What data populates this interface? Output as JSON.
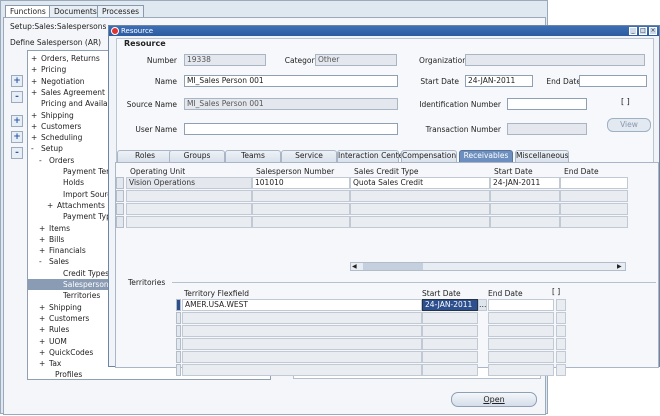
{
  "navigator": {
    "tabs": [
      "Functions",
      "Documents",
      "Processes"
    ],
    "setup_path": "Setup:Sales:Salespersons",
    "define_label": "Define Salesperson (AR)",
    "open_label": "Open",
    "tree": [
      {
        "prefix": "+",
        "label": "Orders, Returns",
        "indent": 0
      },
      {
        "prefix": "+",
        "label": "Pricing",
        "indent": 0
      },
      {
        "prefix": "+",
        "label": "Negotiation",
        "indent": 0
      },
      {
        "prefix": "+",
        "label": "Sales Agreement",
        "indent": 0
      },
      {
        "prefix": "",
        "label": "Pricing and Availability",
        "indent": 0
      },
      {
        "prefix": "+",
        "label": "Shipping",
        "indent": 0
      },
      {
        "prefix": "+",
        "label": "Customers",
        "indent": 0
      },
      {
        "prefix": "+",
        "label": "Scheduling",
        "indent": 0
      },
      {
        "prefix": "-",
        "label": "Setup",
        "indent": 0
      },
      {
        "prefix": "-",
        "label": "Orders",
        "indent": 1
      },
      {
        "prefix": "",
        "label": "Payment Terms",
        "indent": 2
      },
      {
        "prefix": "",
        "label": "Holds",
        "indent": 2
      },
      {
        "prefix": "",
        "label": "Import Sources",
        "indent": 2
      },
      {
        "prefix": "+",
        "label": "Attachments",
        "indent": 2
      },
      {
        "prefix": "",
        "label": "Payment Types",
        "indent": 2
      },
      {
        "prefix": "+",
        "label": "Items",
        "indent": 1
      },
      {
        "prefix": "+",
        "label": "Bills",
        "indent": 1
      },
      {
        "prefix": "+",
        "label": "Financials",
        "indent": 1
      },
      {
        "prefix": "-",
        "label": "Sales",
        "indent": 1
      },
      {
        "prefix": "",
        "label": "Credit Types",
        "indent": 2
      },
      {
        "prefix": "",
        "label": "Salespersons",
        "indent": 2,
        "selected": true
      },
      {
        "prefix": "",
        "label": "Territories",
        "indent": 2
      },
      {
        "prefix": "+",
        "label": "Shipping",
        "indent": 1
      },
      {
        "prefix": "+",
        "label": "Customers",
        "indent": 1
      },
      {
        "prefix": "+",
        "label": "Rules",
        "indent": 1
      },
      {
        "prefix": "+",
        "label": "UOM",
        "indent": 1
      },
      {
        "prefix": "+",
        "label": "QuickCodes",
        "indent": 1
      },
      {
        "prefix": "+",
        "label": "Tax",
        "indent": 1
      },
      {
        "prefix": "",
        "label": "Profiles",
        "indent": 1
      }
    ],
    "side_buttons": [
      "+",
      "-",
      "+",
      "+",
      "-"
    ]
  },
  "resource": {
    "title": "Resource",
    "section_title": "Resource",
    "labels": {
      "number": "Number",
      "category": "Category",
      "organization": "Organization",
      "name": "Name",
      "start_date": "Start Date",
      "end_date": "End Date",
      "source_name": "Source Name",
      "identification_number": "Identification Number",
      "user_name": "User Name",
      "transaction_number": "Transaction Number"
    },
    "values": {
      "number": "19338",
      "category": "Other",
      "organization": "",
      "name": "MI_Sales Person 001",
      "start_date": "24-JAN-2011",
      "end_date": "",
      "source_name": "MI_Sales Person 001",
      "identification_number": "",
      "user_name": "",
      "transaction_number": ""
    },
    "bracket_label": "[ ]",
    "view_label": "View",
    "tabs": [
      "Roles",
      "Groups",
      "Teams",
      "Service",
      "Interaction Center",
      "Compensation",
      "Receivables",
      "Miscellaneous"
    ],
    "active_tab": "Receivables",
    "receivables": {
      "headers": [
        "Operating Unit",
        "Salesperson Number",
        "Sales Credit Type",
        "Start Date",
        "End Date"
      ],
      "rows": [
        [
          "Vision Operations",
          "101010",
          "Quota Sales Credit",
          "24-JAN-2011",
          ""
        ]
      ]
    },
    "territories": {
      "section_label": "Territories",
      "headers": [
        "Territory Flexfield",
        "Start Date",
        "End Date"
      ],
      "bracket_label": "[ ]",
      "rows": [
        [
          "AMER.USA.WEST",
          "24-JAN-2011",
          ""
        ]
      ]
    }
  },
  "colors": {
    "title_bar": "#2d5ba0",
    "active_tab": "#6d8fbf",
    "selection": "#2d4f8e"
  }
}
